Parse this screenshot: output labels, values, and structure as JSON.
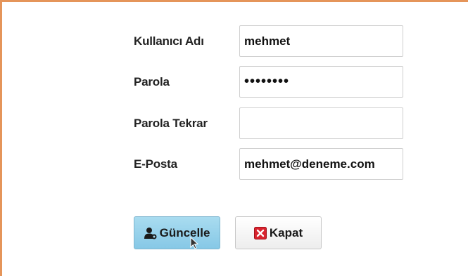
{
  "form": {
    "username": {
      "label": "Kullanıcı Adı",
      "value": "mehmet"
    },
    "password": {
      "label": "Parola",
      "value": "••••••••"
    },
    "password_repeat": {
      "label": "Parola Tekrar",
      "value": ""
    },
    "email": {
      "label": "E-Posta",
      "value": "mehmet@deneme.com"
    }
  },
  "buttons": {
    "update": {
      "label": "Güncelle",
      "icon": "user-edit-icon"
    },
    "close": {
      "label": "Kapat",
      "icon": "close-x-icon"
    }
  },
  "colors": {
    "frame_border": "#e5955a",
    "update_button": "#86c8e6",
    "close_icon": "#d9232e"
  }
}
